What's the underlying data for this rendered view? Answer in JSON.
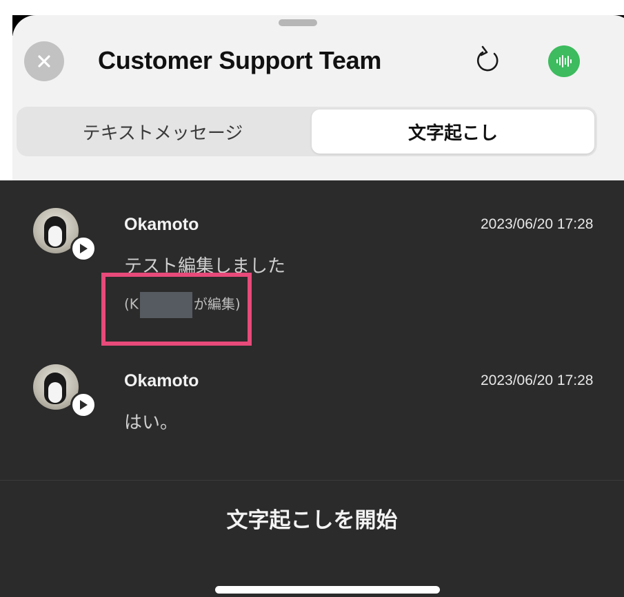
{
  "header": {
    "title": "Customer Support Team",
    "close_icon": "close-icon",
    "refresh_icon": "refresh-icon",
    "voice_icon": "waveform-icon",
    "voice_color": "#3dbb5e"
  },
  "tabs": [
    {
      "label": "テキストメッセージ",
      "active": false
    },
    {
      "label": "文字起こし",
      "active": true
    }
  ],
  "messages": [
    {
      "sender": "Okamoto",
      "timestamp": "2023/06/20 17:28",
      "text": "テスト編集しました",
      "edited_prefix": "(K",
      "edited_suffix": "が編集)"
    },
    {
      "sender": "Okamoto",
      "timestamp": "2023/06/20 17:28",
      "text": "はい。"
    }
  ],
  "footer": {
    "start_label": "文字起こしを開始"
  },
  "colors": {
    "highlight": "#e84a7a",
    "dark_bg": "#2b2b2b"
  }
}
